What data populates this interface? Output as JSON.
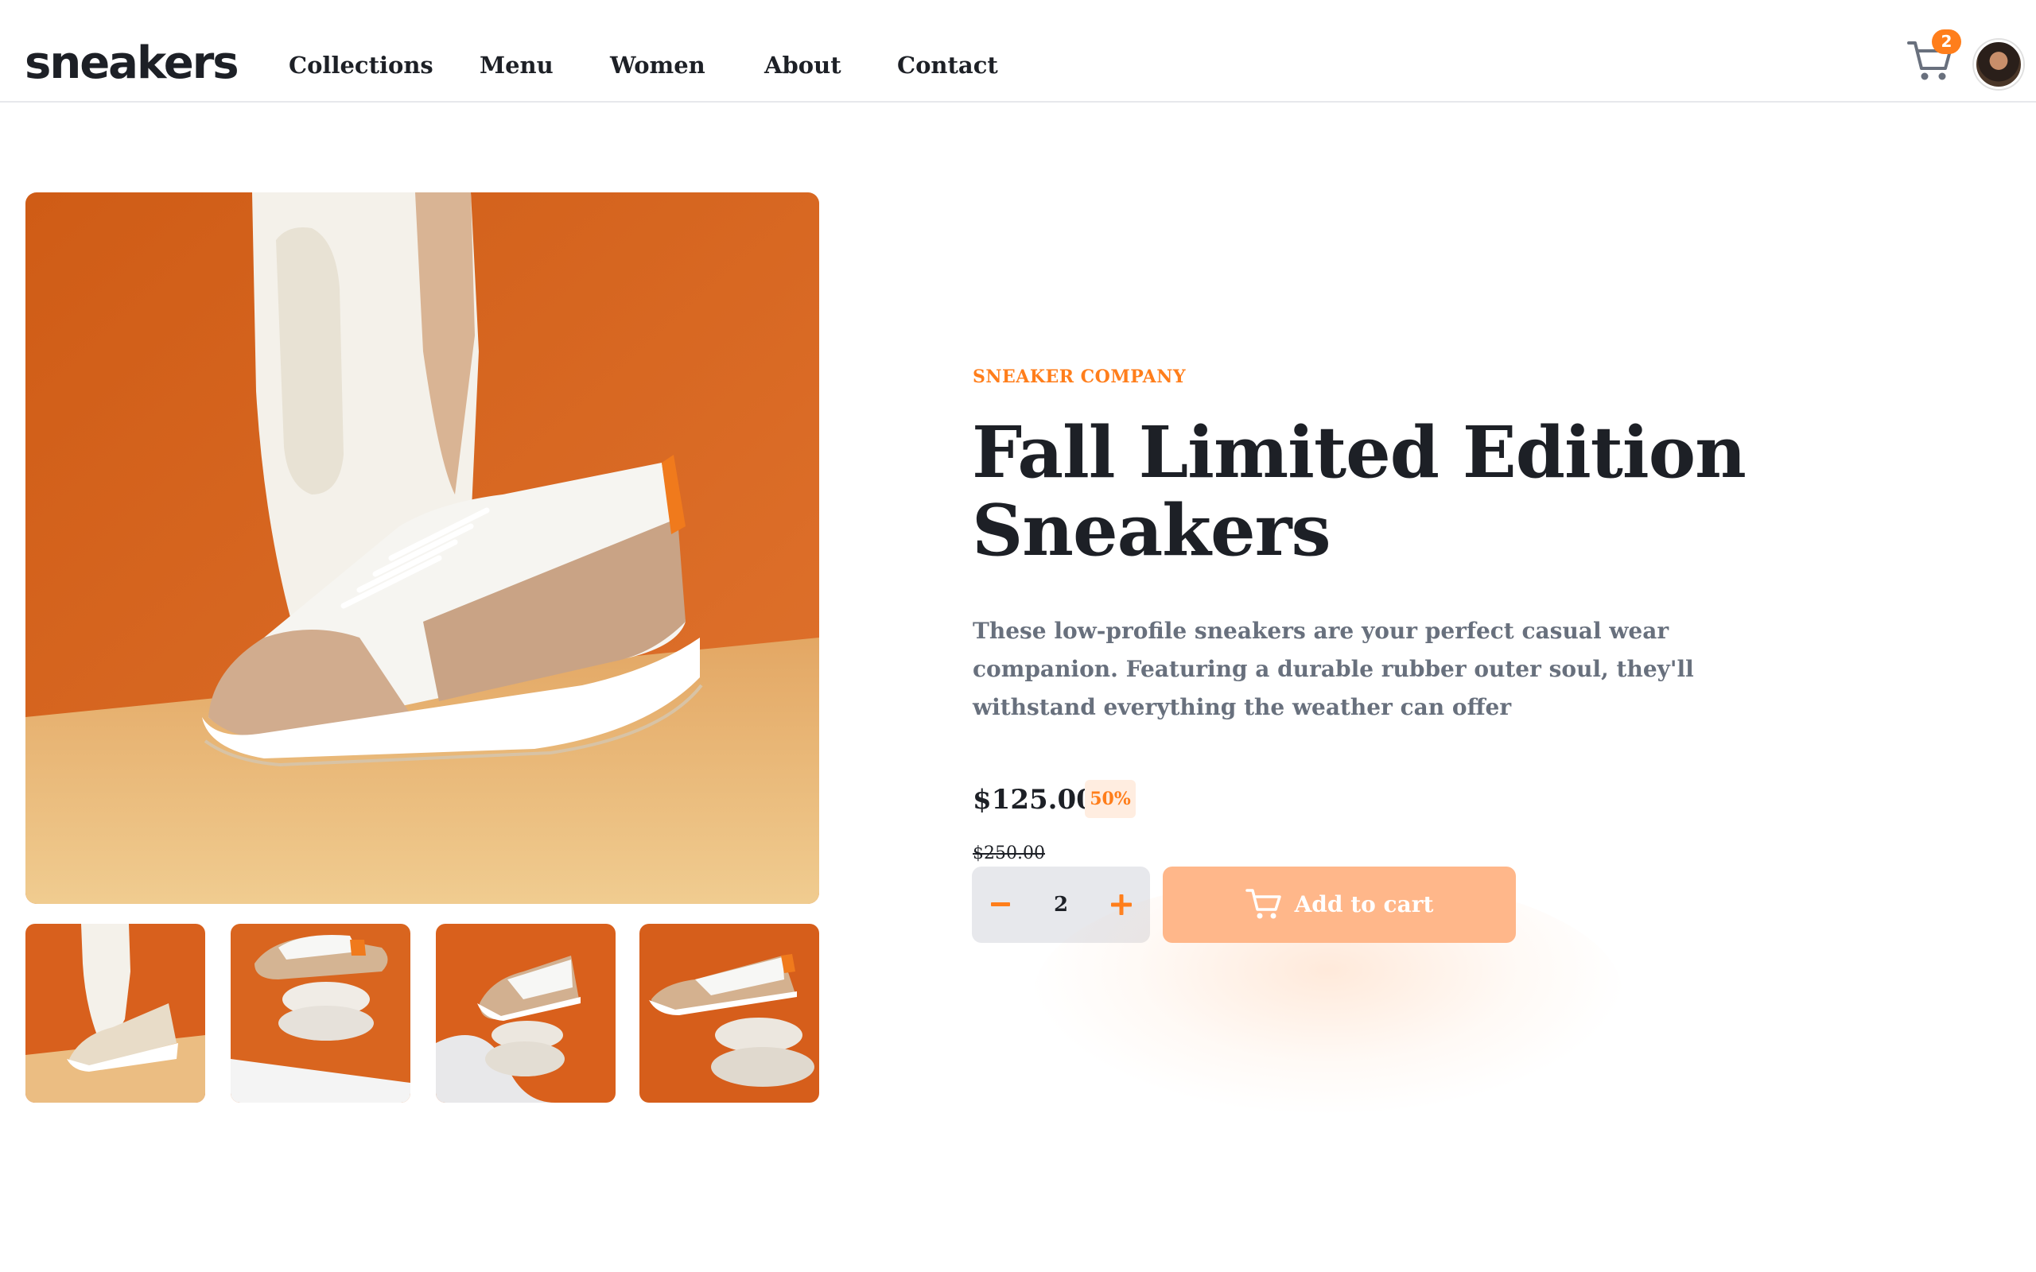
{
  "header": {
    "logo": "sneakers",
    "nav": [
      "Collections",
      "Menu",
      "Women",
      "About",
      "Contact"
    ],
    "cart_count": "2"
  },
  "product": {
    "company": "SNEAKER COMPANY",
    "title": "Fall Limited Edition Sneakers",
    "description": "These low-profile sneakers are your perfect casual wear companion. Featuring a durable rubber outer soul, they'll withstand everything the weather can offer",
    "price": "$125.00",
    "discount": "50%",
    "original_price": "$250.00",
    "quantity": "2",
    "add_to_cart_label": "Add to cart"
  },
  "colors": {
    "accent": "#ff7e1b",
    "accent_pale": "#ffede0",
    "button_disabled": "#ffb78a",
    "text_dark": "#1d2026",
    "text_gray": "#68707d",
    "stepper_bg": "#e7e8ec"
  },
  "icons": {
    "cart": "cart-icon",
    "minus": "minus-icon",
    "plus": "plus-icon"
  }
}
